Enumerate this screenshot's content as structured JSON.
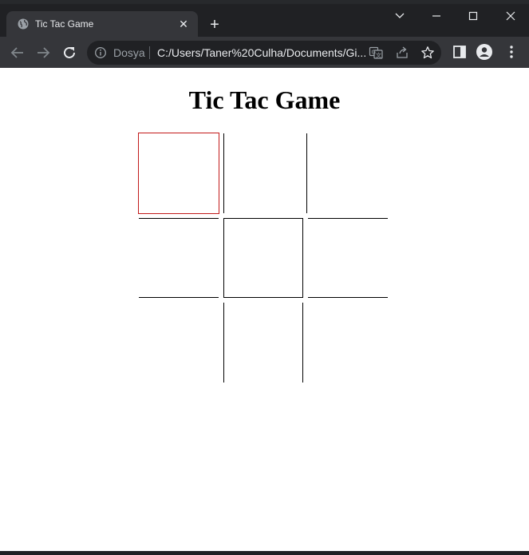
{
  "browser": {
    "tab": {
      "title": "Tic Tac Game",
      "close_symbol": "✕",
      "favicon": "globe-icon"
    },
    "new_tab_symbol": "+",
    "window_controls": [
      "chevron-down-icon",
      "minimize-icon",
      "maximize-icon",
      "close-icon"
    ],
    "address_bar": {
      "security_chip": "Dosya",
      "url": "C:/Users/Taner%20Culha/Documents/Gi..."
    },
    "colors": {
      "chrome_dark": "#202124",
      "chrome_toolbar": "#35363a",
      "text": "#e8eaed"
    }
  },
  "page": {
    "title": "Tic Tac Game",
    "board": {
      "cells": [
        "",
        "",
        "",
        "",
        "",
        "",
        "",
        "",
        ""
      ],
      "focused_cell": 0,
      "focus_color": "#c21a1a"
    }
  }
}
